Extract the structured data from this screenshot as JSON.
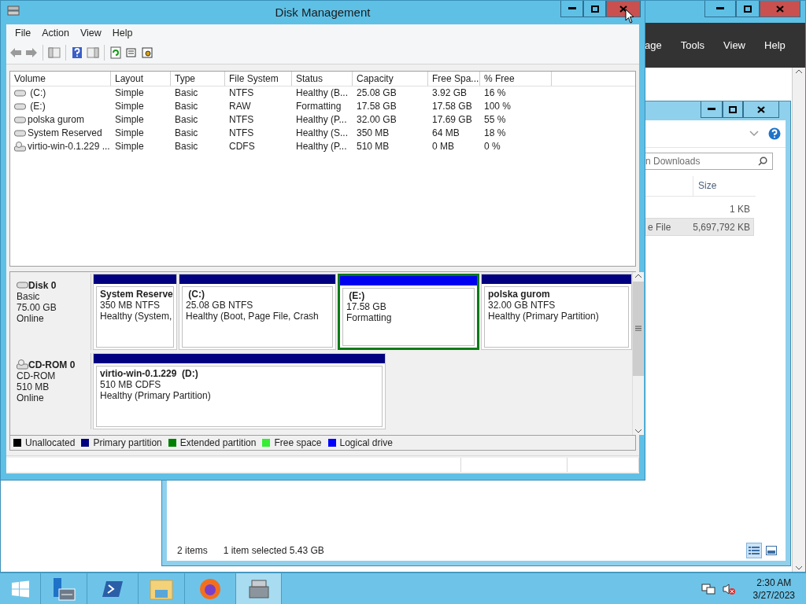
{
  "server_manager": {
    "menu": [
      "age",
      "Tools",
      "View",
      "Help"
    ]
  },
  "explorer": {
    "search": {
      "placeholder": "n Downloads"
    },
    "columns": [
      "Size"
    ],
    "rows": [
      {
        "size": "1 KB",
        "selected": false
      },
      {
        "name": "e File",
        "size": "5,697,792 KB",
        "selected": true
      }
    ],
    "status": [
      "2 items",
      "1 item selected  5.43 GB"
    ]
  },
  "disk_management": {
    "title": "Disk Management",
    "menu": [
      "File",
      "Action",
      "View",
      "Help"
    ],
    "columns": [
      "Volume",
      "Layout",
      "Type",
      "File System",
      "Status",
      "Capacity",
      "Free Spa...",
      "% Free"
    ],
    "volumes": [
      {
        "kind": "disk",
        "cells": [
          " (C:)",
          "Simple",
          "Basic",
          "NTFS",
          "Healthy (B...",
          "25.08 GB",
          "3.92 GB",
          "16 %"
        ]
      },
      {
        "kind": "disk",
        "cells": [
          " (E:)",
          "Simple",
          "Basic",
          "RAW",
          "Formatting",
          "17.58 GB",
          "17.58 GB",
          "100 %"
        ]
      },
      {
        "kind": "disk",
        "cells": [
          "polska gurom",
          "Simple",
          "Basic",
          "NTFS",
          "Healthy (P...",
          "32.00 GB",
          "17.69 GB",
          "55 %"
        ]
      },
      {
        "kind": "disk",
        "cells": [
          "System Reserved",
          "Simple",
          "Basic",
          "NTFS",
          "Healthy (S...",
          "350 MB",
          "64 MB",
          "18 %"
        ]
      },
      {
        "kind": "cd",
        "cells": [
          "virtio-win-0.1.229 ...",
          "Simple",
          "Basic",
          "CDFS",
          "Healthy (P...",
          "510 MB",
          "0 MB",
          "0 %"
        ]
      }
    ],
    "disks": [
      {
        "kind": "disk",
        "name": "Disk 0",
        "type": "Basic",
        "size": "75.00 GB",
        "status": "Online",
        "partitions": [
          {
            "kind": "primary",
            "selected": false,
            "title": "System Reserve",
            "size": "350 MB NTFS",
            "status": "Healthy (System,"
          },
          {
            "kind": "primary",
            "selected": false,
            "title": " (C:)",
            "size": "25.08 GB NTFS",
            "status": "Healthy (Boot, Page File, Crash"
          },
          {
            "kind": "logical",
            "selected": true,
            "title": " (E:)",
            "size": "17.58 GB",
            "status": "Formatting"
          },
          {
            "kind": "primary",
            "selected": false,
            "title": "polska gurom",
            "size": "32.00 GB NTFS",
            "status": "Healthy (Primary Partition)"
          }
        ]
      },
      {
        "kind": "cd",
        "name": "CD-ROM 0",
        "type": "CD-ROM",
        "size": "510 MB",
        "status": "Online",
        "partitions": [
          {
            "kind": "primary",
            "selected": false,
            "title": "virtio-win-0.1.229  (D:)",
            "size": "510 MB CDFS",
            "status": "Healthy (Primary Partition)"
          }
        ]
      }
    ],
    "legend": [
      {
        "label": "Unallocated",
        "color": "#000000"
      },
      {
        "label": "Primary partition",
        "color": "#000080"
      },
      {
        "label": "Extended partition",
        "color": "#008000"
      },
      {
        "label": "Free space",
        "color": "#33ee33"
      },
      {
        "label": "Logical drive",
        "color": "#0000ff"
      }
    ]
  },
  "taskbar": {
    "time": "2:30 AM",
    "date": "3/27/2023"
  }
}
